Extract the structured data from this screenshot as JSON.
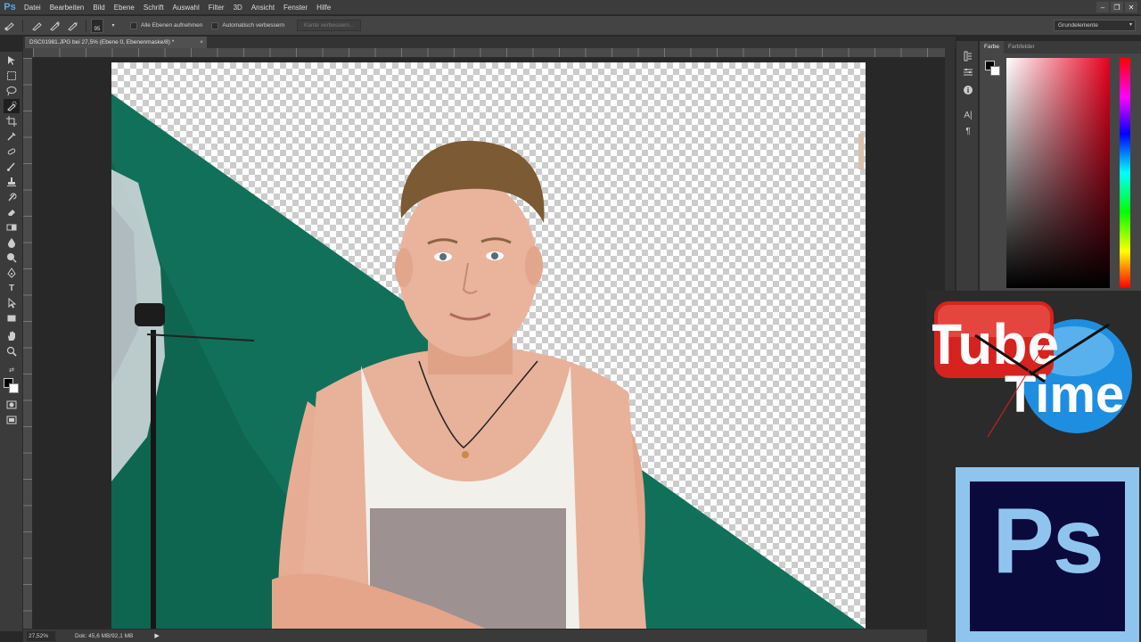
{
  "app": {
    "logo": "Ps"
  },
  "menu": [
    "Datei",
    "Bearbeiten",
    "Bild",
    "Ebene",
    "Schrift",
    "Auswahl",
    "Filter",
    "3D",
    "Ansicht",
    "Fenster",
    "Hilfe"
  ],
  "window_controls": [
    "–",
    "❐",
    "✕"
  ],
  "options": {
    "brush_size": "95",
    "sample_all_layers_label": "Alle Ebenen aufnehmen",
    "auto_enhance_label": "Automatisch verbessern",
    "refine_edge_label": "Kante verbessern...",
    "workspace": "Grundelemente"
  },
  "document": {
    "tab_title": "DSC01981.JPG bei 27,5% (Ebene 0, Ebenenmaske/8) *",
    "close": "×"
  },
  "status": {
    "zoom": "27,52%",
    "doc_size": "Dok: 45,6 MB/92,1 MB",
    "arrow": "▶"
  },
  "color_panel": {
    "tabs": [
      "Farbe",
      "Farbfelder"
    ],
    "foreground": "#000000",
    "background": "#ffffff"
  },
  "logos": {
    "tube": "Tube",
    "time": "Time",
    "ps": "Ps"
  },
  "colors": {
    "backdrop_green": "#11705a",
    "tube_red": "#d6231f",
    "time_blue": "#1e8fe0",
    "ps_blue": "#8fc4ee",
    "ps_dark": "#0b0a3d"
  }
}
